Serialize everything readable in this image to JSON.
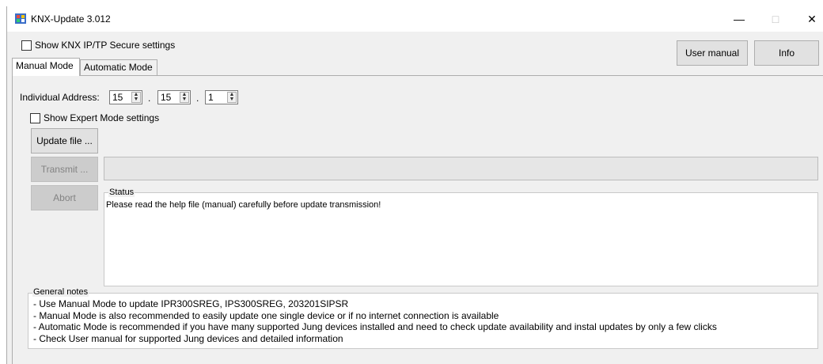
{
  "window": {
    "title": "KNX-Update 3.012",
    "minimize": "—",
    "maximize": "□",
    "close": "✕"
  },
  "top": {
    "secure_checkbox_label": "Show KNX IP/TP Secure settings",
    "user_manual_button": "User manual",
    "info_button": "Info"
  },
  "tabs": [
    {
      "label": "Manual Mode",
      "active": true
    },
    {
      "label": "Automatic Mode",
      "active": false
    }
  ],
  "manual": {
    "address_label": "Individual Address:",
    "address": [
      "15",
      "15",
      "1"
    ],
    "separator": ".",
    "expert_checkbox_label": "Show Expert Mode settings",
    "update_file_button": "Update file ...",
    "transmit_button": "Transmit ...",
    "abort_button": "Abort",
    "progress": 0,
    "status_title": "Status",
    "status_text": "Please read the help file (manual) carefully before update transmission!"
  },
  "notes": {
    "title": "General notes",
    "lines": [
      "- Use Manual Mode to update IPR300SREG, IPS300SREG, 203201SIPSR",
      "- Manual Mode is also recommended to easily update one single device or if no internet connection is available",
      "- Automatic Mode is recommended if you have many supported Jung devices installed and need to check update availability and instal updates by only a few clicks",
      "- Check User manual for supported Jung devices and detailed information"
    ]
  }
}
